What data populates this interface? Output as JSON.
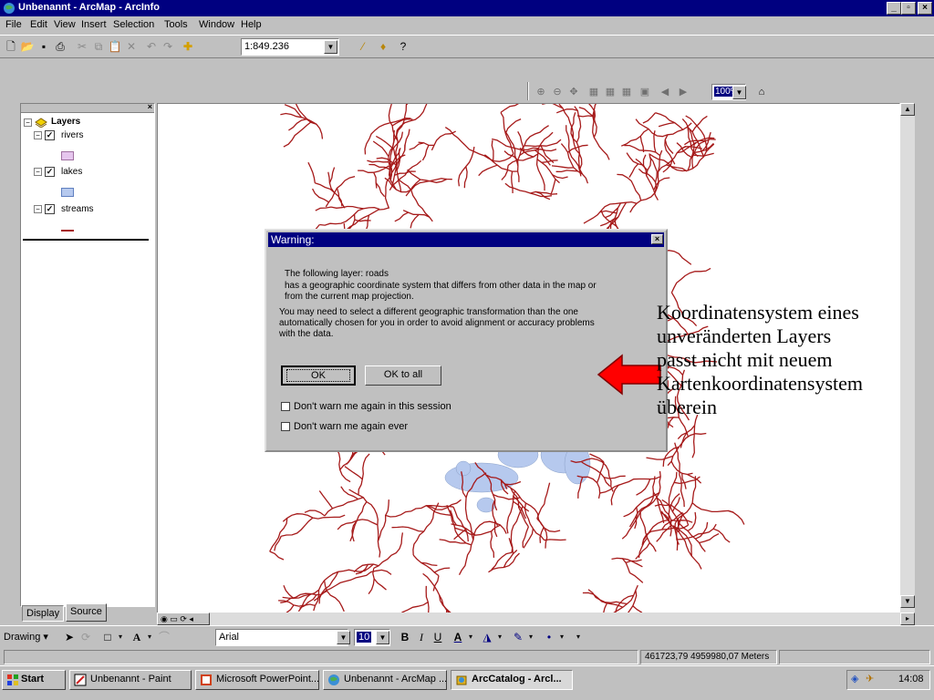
{
  "window": {
    "title": "Unbenannt - ArcMap - ArcInfo"
  },
  "menu": [
    "File",
    "Edit",
    "View",
    "Insert",
    "Selection",
    "Tools",
    "Window",
    "Help"
  ],
  "toolbar": {
    "scale": "1:849.236",
    "zoom_percent": "100%"
  },
  "toc": {
    "root_label": "Layers",
    "layers": [
      {
        "label": "rivers",
        "swatch_color": "#e6c6ee"
      },
      {
        "label": "lakes",
        "swatch_color": "#b6c9ee"
      },
      {
        "label": "streams",
        "swatch_color": "#a61a1a"
      }
    ],
    "tabs": [
      "Display",
      "Source"
    ]
  },
  "dialog": {
    "title": "Warning:",
    "line1": "The following layer:    roads",
    "line2": "has a geographic coordinate system that differs from other data in the map or",
    "line3": "from the current map projection.",
    "line4": "You may need to select a different geographic transformation than the one",
    "line5": "automatically chosen for you in order to avoid alignment or accuracy problems",
    "line6": "with the data.",
    "ok_label": "OK",
    "ok_all_label": "OK to all",
    "checkbox1": "Don't warn me again in this session",
    "checkbox2": "Don't warn me again ever"
  },
  "annotation": {
    "line1": "Koordinatensystem eines",
    "line2": "unveränderten Layers",
    "line3": "passt nicht mit neuem",
    "line4": "Kartenkoordinatensystem",
    "line5": "überein"
  },
  "drawing": {
    "label": "Drawing",
    "font": "Arial",
    "size": "10"
  },
  "status": {
    "coordinates": "461723,79  4959980,07 Meters"
  },
  "taskbar": {
    "start": "Start",
    "items": [
      "Unbenannt - Paint",
      "Microsoft PowerPoint...",
      "Unbenannt - ArcMap ...",
      "ArcCatalog - Arcl..."
    ],
    "clock": "14:08"
  },
  "colors": {
    "river": "#a61a1a",
    "lake": "#b6c9ee",
    "titlebar": "#000080",
    "arrow": "#ff0000"
  }
}
